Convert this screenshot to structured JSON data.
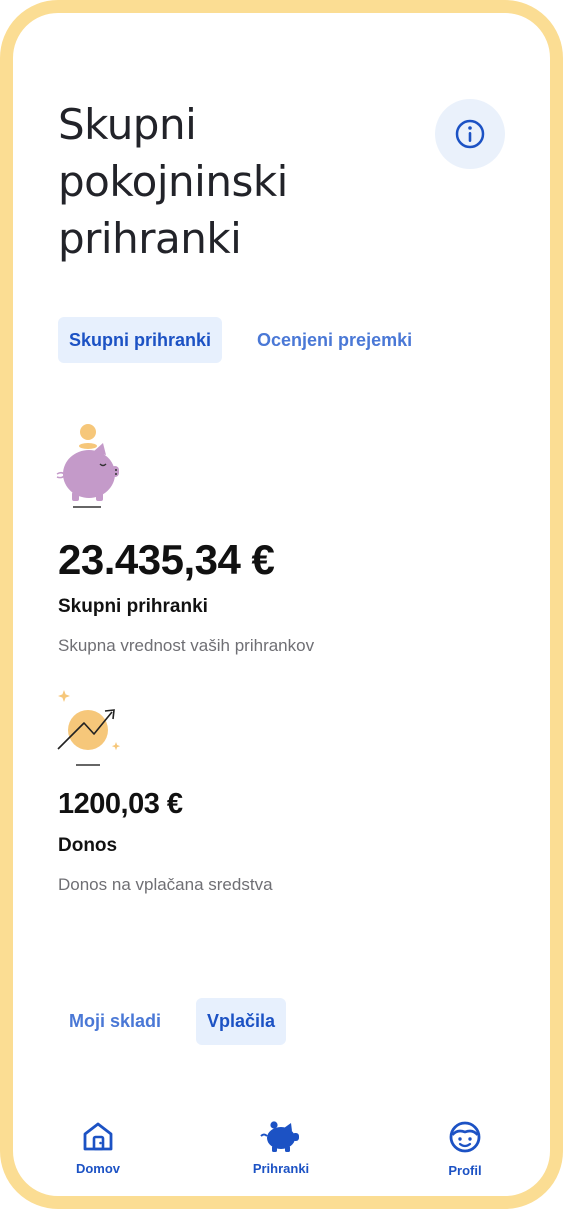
{
  "page": {
    "title": "Skupni pokojninski prihranki"
  },
  "tabs": [
    {
      "label": "Skupni prihranki",
      "active": true
    },
    {
      "label": "Ocenjeni prejemki",
      "active": false
    }
  ],
  "metrics": [
    {
      "icon": "piggy-bank-icon",
      "amount": "23.435,34 €",
      "label": "Skupni prihranki",
      "description": "Skupna vrednost vaših prihrankov"
    },
    {
      "icon": "growth-chart-icon",
      "amount": "1200,03 €",
      "label": "Donos",
      "description": "Donos na vplačana sredstva"
    }
  ],
  "bottom_tabs": [
    {
      "label": "Moji skladi",
      "active": false
    },
    {
      "label": "Vplačila",
      "active": true
    }
  ],
  "nav": [
    {
      "icon": "home-icon",
      "label": "Domov"
    },
    {
      "icon": "piggy-icon",
      "label": "Prihranki",
      "active": true
    },
    {
      "icon": "profile-face-icon",
      "label": "Profil"
    }
  ],
  "colors": {
    "frame": "#fbdd93",
    "accent": "#1c52c4",
    "tab_active_bg": "#e7f0fd",
    "piggy": "#c49ac9",
    "coin": "#f6c77a"
  }
}
